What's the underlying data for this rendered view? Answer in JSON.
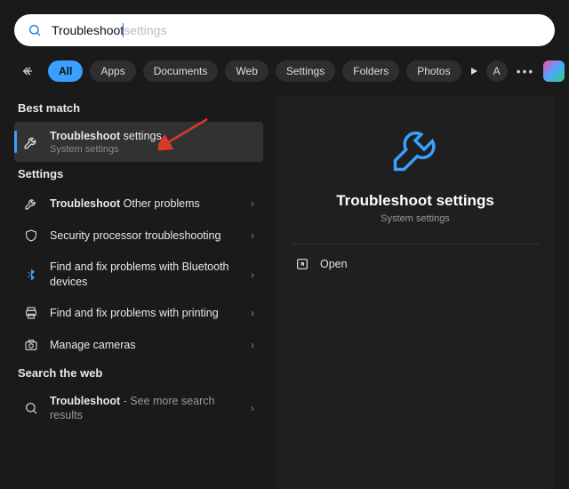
{
  "search": {
    "typed": "Troubleshoot",
    "suggestion_tail": " settings"
  },
  "filters": {
    "items": [
      "All",
      "Apps",
      "Documents",
      "Web",
      "Settings",
      "Folders",
      "Photos"
    ],
    "active_index": 0
  },
  "avatar_letter": "A",
  "sections": {
    "best_match_title": "Best match",
    "settings_title": "Settings",
    "web_title": "Search the web"
  },
  "best_match": {
    "title_bold": "Troubleshoot",
    "title_rest": " settings",
    "subtitle": "System settings"
  },
  "settings_results": [
    {
      "title_bold": "Troubleshoot",
      "title_rest": " Other problems",
      "icon": "wrench"
    },
    {
      "title_plain": "Security processor troubleshooting",
      "icon": "shield"
    },
    {
      "title_plain": "Find and fix problems with Bluetooth devices",
      "icon": "bluetooth"
    },
    {
      "title_plain": "Find and fix problems with printing",
      "icon": "printer"
    },
    {
      "title_plain": "Manage cameras",
      "icon": "camera"
    }
  ],
  "web_result": {
    "title_bold": "Troubleshoot",
    "tail": " - See more search results"
  },
  "panel": {
    "title": "Troubleshoot settings",
    "subtitle": "System settings",
    "open_label": "Open"
  }
}
